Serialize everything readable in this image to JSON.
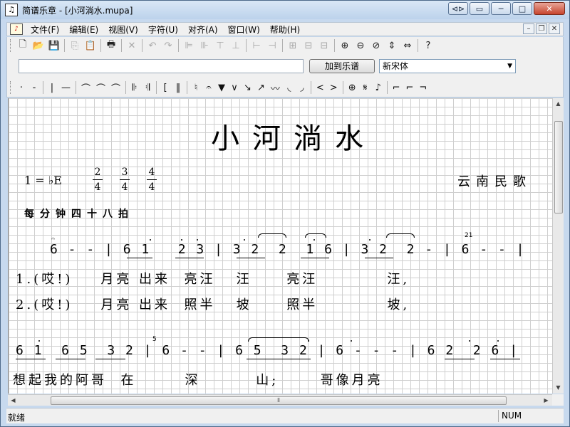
{
  "window": {
    "title": "简谱乐章 - [小河淌水.mupa]",
    "app_icon_glyph": "♫",
    "minimize": "⊲⊳",
    "restore": "▭",
    "max": "─",
    "max2": "□",
    "close": "✕"
  },
  "menu": {
    "doc_icon": "♪",
    "items": [
      "文件(F)",
      "编辑(E)",
      "视图(V)",
      "字符(U)",
      "对齐(A)",
      "窗口(W)",
      "帮助(H)"
    ],
    "mdi_min": "–",
    "mdi_restore": "❐",
    "mdi_close": "✕"
  },
  "toolbar1": {
    "icons": [
      "new-icon",
      "open-icon",
      "save-icon",
      "copy-icon",
      "paste-icon",
      "print-icon",
      "cut-icon",
      "undo-icon",
      "redo-icon",
      "align-left-icon",
      "align-right-icon",
      "align-top-icon",
      "align-bottom-icon",
      "distribute-h-icon",
      "distribute-v-icon",
      "group-icon",
      "ungroup-icon",
      "zoom-in-icon",
      "zoom-out-icon",
      "zoom-reset-icon",
      "fit-height-icon",
      "fit-width-icon",
      "help-icon"
    ],
    "glyphs": [
      "🗋",
      "📂",
      "💾",
      "⎘",
      "📋",
      "🖶",
      "✕",
      "↶",
      "↷",
      "⊫",
      "⊪",
      "⊤",
      "⊥",
      "⊢",
      "⊣",
      "⊞",
      "⊟",
      "⊕",
      "⊖",
      "⊘",
      "⇕",
      "⇔",
      "?"
    ]
  },
  "toolbar2": {
    "text_input_value": "",
    "add_button": "加到乐谱",
    "font_value": "新宋体"
  },
  "toolbar3": {
    "symbols": [
      "·",
      "-",
      "|",
      "—",
      "⌒",
      "⌒",
      "⌒",
      "𝄆",
      "𝄇",
      "[",
      "‖",
      "♮",
      "𝄐",
      "▼",
      "∨",
      "↘",
      "↗",
      "〰",
      "◟",
      "◞",
      "<",
      ">",
      "⊕",
      "𝄋",
      "♪",
      "⌐",
      "⌐",
      "¬"
    ]
  },
  "score": {
    "title": "小河淌水",
    "key": "1 = ♭E",
    "time_sigs": [
      {
        "top": "2",
        "bottom": "4"
      },
      {
        "top": "3",
        "bottom": "4"
      },
      {
        "top": "4",
        "bottom": "4"
      }
    ],
    "composer": "云南民歌",
    "tempo": "每分钟四十八拍",
    "line1_notes": "6 - - | 6 1   2 3 | 3 2  2  1 6 | 3 2  2 - | 6 - - |",
    "lyric1": "1.(哎!)    月亮 出来  亮汪   汪     亮汪          汪,",
    "lyric2": "2.(哎!)    月亮 出来  照半   坡     照半          坡,",
    "grace1": "21",
    "line2_notes": "6 1  6 5  3 2 | 6 - - | 6 5  3 2 | 6 - - - | 6 2  2 6 |",
    "grace2": "5",
    "lyric3": "想起我的阿哥  在       深        山;      哥像月亮"
  },
  "status": {
    "left": "就绪",
    "num": "NUM"
  }
}
